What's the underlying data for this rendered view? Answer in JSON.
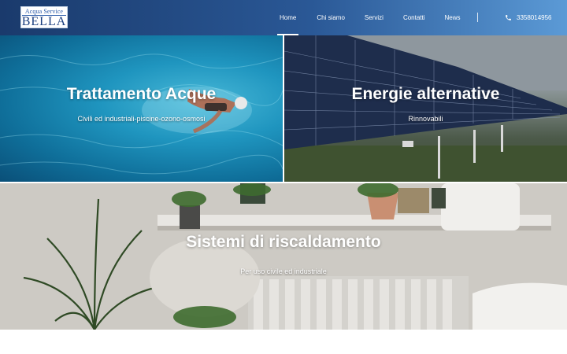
{
  "header": {
    "logo": {
      "top_text": "Acqua Service",
      "main_text": "BELLA"
    },
    "nav": [
      {
        "label": "Home",
        "active": true
      },
      {
        "label": "Chi siamo",
        "active": false
      },
      {
        "label": "Servizi",
        "active": false
      },
      {
        "label": "Contatti",
        "active": false
      },
      {
        "label": "News",
        "active": false
      }
    ],
    "phone": {
      "icon": "phone-icon",
      "number": "3358014956"
    },
    "colors": {
      "gradient_start": "#1a3a6c",
      "gradient_end": "#5b9ad6"
    }
  },
  "tiles": [
    {
      "title": "Trattamento Acque",
      "subtitle": "Civili ed industriali-piscine-ozono-osmosi"
    },
    {
      "title": "Energie alternative",
      "subtitle": "Rinnovabili"
    },
    {
      "title": "Sistemi di riscaldamento",
      "subtitle": "Per uso civile ed industriale"
    }
  ]
}
